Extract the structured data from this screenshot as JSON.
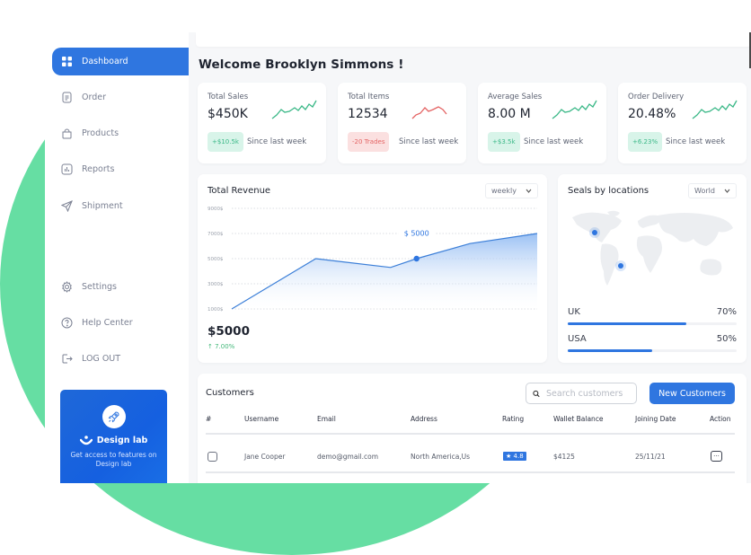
{
  "sidebar": {
    "items": [
      {
        "label": "Dashboard",
        "icon": "grid-icon",
        "active": true
      },
      {
        "label": "Order",
        "icon": "document-icon"
      },
      {
        "label": "Products",
        "icon": "shopping-bag-icon"
      },
      {
        "label": "Reports",
        "icon": "bar-chart-icon"
      },
      {
        "label": "Shipment",
        "icon": "send-icon"
      },
      {
        "label": "Settings",
        "icon": "gear-icon"
      },
      {
        "label": "Help Center",
        "icon": "help-icon"
      },
      {
        "label": "LOG OUT",
        "icon": "logout-icon"
      }
    ],
    "promo": {
      "icon": "rocket-icon",
      "brand": "Design lab",
      "description": "Get access to features on Design lab"
    }
  },
  "header": {
    "welcome": "Welcome Brooklyn Simmons !"
  },
  "stats": [
    {
      "label": "Total Sales",
      "value": "$450K",
      "badge": "+$10.5k",
      "trend": "up",
      "since": "Since last week"
    },
    {
      "label": "Total Items",
      "value": "12534",
      "badge": "-20 Trades",
      "trend": "down",
      "since": "Since last week"
    },
    {
      "label": "Average Sales",
      "value": "8.00 M",
      "badge": "+$3.5k",
      "trend": "up",
      "since": "Since last week"
    },
    {
      "label": "Order Delivery",
      "value": "20.48%",
      "badge": "+6.23%",
      "trend": "up",
      "since": "Since last week"
    }
  ],
  "colors": {
    "accent": "#2f76e0",
    "positive": "#3ab887",
    "negative": "#e46363",
    "background_circle": "#66dea3"
  },
  "revenue": {
    "title": "Total Revenue",
    "period": "weekly",
    "amount": "$5000",
    "change": "7.00%",
    "tooltip": "$ 5000"
  },
  "chart_data": {
    "type": "area",
    "title": "Total Revenue",
    "xlabel": "",
    "ylabel": "",
    "y_ticks": [
      "9000$",
      "7000$",
      "5000$",
      "3000$",
      "1000$"
    ],
    "ylim": [
      1000,
      9000
    ],
    "grid": true,
    "x": [
      0,
      1,
      2,
      3,
      4,
      5
    ],
    "values": [
      1000,
      5000,
      4300,
      5000,
      6200,
      7000
    ],
    "highlight": {
      "index": 3,
      "value": 5000,
      "label": "$ 5000"
    }
  },
  "locations": {
    "title": "Seals by locations",
    "scope": "World",
    "items": [
      {
        "country": "UK",
        "percent": 70
      },
      {
        "country": "USA",
        "percent": 50
      }
    ]
  },
  "customers": {
    "title": "Customers",
    "search_placeholder": "Search customers",
    "new_button": "New Customers",
    "columns": [
      "#",
      "Username",
      "Email",
      "Address",
      "Rating",
      "Wallet Balance",
      "Joining Date",
      "Action"
    ],
    "rows": [
      {
        "username": "Jane Cooper",
        "email": "demo@gmail.com",
        "address": "North America,Us",
        "rating": "4.8",
        "wallet": "$4125",
        "joined": "25/11/21"
      }
    ]
  }
}
